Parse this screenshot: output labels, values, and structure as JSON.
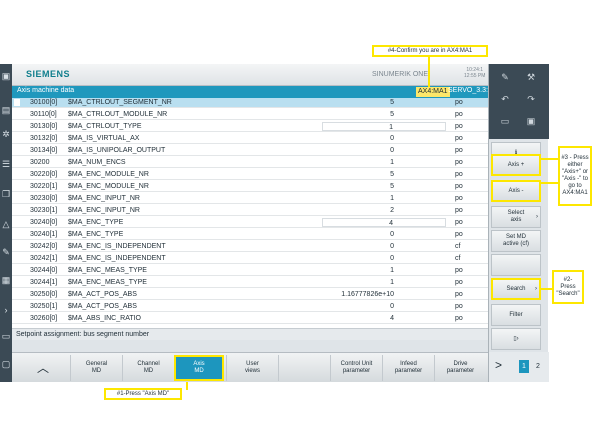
{
  "header": {
    "brand": "SIEMENS",
    "product": "SINUMERIK ONE",
    "time": "10:24:1\n12:55 PM"
  },
  "titlebar": {
    "title": "Axis machine data",
    "axis": "AX4:MA1",
    "drive": "SERVO_3.3:7"
  },
  "table": {
    "rows": [
      {
        "num": "30100[0]",
        "name": "$MA_CTRLOUT_SEGMENT_NR",
        "value": "5",
        "unit": "po"
      },
      {
        "num": "30110[0]",
        "name": "$MA_CTRLOUT_MODULE_NR",
        "value": "5",
        "unit": "po"
      },
      {
        "num": "30130[0]",
        "name": "$MA_CTRLOUT_TYPE",
        "value": "1",
        "unit": "po"
      },
      {
        "num": "30132[0]",
        "name": "$MA_IS_VIRTUAL_AX",
        "value": "0",
        "unit": "po"
      },
      {
        "num": "30134[0]",
        "name": "$MA_IS_UNIPOLAR_OUTPUT",
        "value": "0",
        "unit": "po"
      },
      {
        "num": "30200",
        "name": "$MA_NUM_ENCS",
        "value": "1",
        "unit": "po"
      },
      {
        "num": "30220[0]",
        "name": "$MA_ENC_MODULE_NR",
        "value": "5",
        "unit": "po"
      },
      {
        "num": "30220[1]",
        "name": "$MA_ENC_MODULE_NR",
        "value": "5",
        "unit": "po"
      },
      {
        "num": "30230[0]",
        "name": "$MA_ENC_INPUT_NR",
        "value": "1",
        "unit": "po"
      },
      {
        "num": "30230[1]",
        "name": "$MA_ENC_INPUT_NR",
        "value": "2",
        "unit": "po"
      },
      {
        "num": "30240[0]",
        "name": "$MA_ENC_TYPE",
        "value": "4",
        "unit": "po"
      },
      {
        "num": "30240[1]",
        "name": "$MA_ENC_TYPE",
        "value": "0",
        "unit": "po"
      },
      {
        "num": "30242[0]",
        "name": "$MA_ENC_IS_INDEPENDENT",
        "value": "0",
        "unit": "cf"
      },
      {
        "num": "30242[1]",
        "name": "$MA_ENC_IS_INDEPENDENT",
        "value": "0",
        "unit": "cf"
      },
      {
        "num": "30244[0]",
        "name": "$MA_ENC_MEAS_TYPE",
        "value": "1",
        "unit": "po"
      },
      {
        "num": "30244[1]",
        "name": "$MA_ENC_MEAS_TYPE",
        "value": "1",
        "unit": "po"
      },
      {
        "num": "30250[0]",
        "name": "$MA_ACT_POS_ABS",
        "value": "1.16777826e+10",
        "unit": "po"
      },
      {
        "num": "30250[1]",
        "name": "$MA_ACT_POS_ABS",
        "value": "0",
        "unit": "po"
      },
      {
        "num": "30260[0]",
        "name": "$MA_ABS_INC_RATIO",
        "value": "4",
        "unit": "po"
      }
    ]
  },
  "status": "Setpoint assignment: bus segment number",
  "hsoftkeys": {
    "general": "General\nMD",
    "channel": "Channel\nMD",
    "axis": "Axis\nMD",
    "user": "User\nviews",
    "control": "Control Unit\nparameter",
    "infeed": "Infeed\nparameter",
    "drive": "Drive\nparameter"
  },
  "vsoftkeys": {
    "axis_plus": "Axis +",
    "axis_minus": "Axis -",
    "select_axis": "Select\naxis",
    "set_md": "Set MD\nactive (cf)",
    "search": "Search",
    "filter": "Filter"
  },
  "pages": {
    "p1": "1",
    "p2": "2"
  },
  "annotations": {
    "a1": "#1-Press \"Axis MD\"",
    "a2": "#2-\nPress\n\"Search\"",
    "a3": "#3 - Press\neither\n\"Axis+\" or\n\"Axis -\" to\ngo to\nAX4:MA1",
    "a4": "#4-Confirm you are in AX4:MA1"
  },
  "colors": {
    "accent": "#1f98bd",
    "highlight": "#fde700"
  }
}
